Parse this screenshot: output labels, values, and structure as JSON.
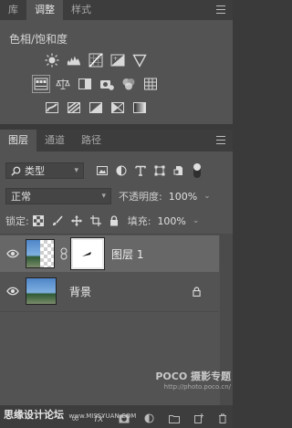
{
  "adjust_panel": {
    "tabs": [
      "库",
      "调整",
      "样式"
    ],
    "active_tab": 1,
    "title": "色相/饱和度",
    "row1": [
      "brightness-icon",
      "levels-icon",
      "curves-icon",
      "exposure-icon",
      "vibrance-icon"
    ],
    "row2": [
      "hue-saturation-icon",
      "color-balance-icon",
      "black-white-icon",
      "photo-filter-icon",
      "channel-mixer-icon",
      "color-lookup-icon"
    ],
    "row3": [
      "invert-icon",
      "posterize-icon",
      "threshold-icon",
      "selective-color-icon",
      "gradient-map-icon"
    ]
  },
  "layers_panel": {
    "tabs": [
      "图层",
      "通道",
      "路径"
    ],
    "active_tab": 0,
    "filter_label": "类型",
    "blend_mode": "正常",
    "opacity_label": "不透明度:",
    "opacity_value": "100%",
    "lock_label": "锁定:",
    "fill_label": "填充:",
    "fill_value": "100%",
    "layers": [
      {
        "name": "图层 1",
        "selected": true,
        "has_mask": true
      },
      {
        "name": "背景",
        "selected": false,
        "locked": true
      }
    ]
  },
  "watermark": {
    "poco": "POCO 摄影专题",
    "url": "http://photo.poco.cn/",
    "site": "思缘设计论坛",
    "site_url": "www.MISSYUAN.COM"
  },
  "colors": {
    "panel": "#535353",
    "dark": "#3a3a3a",
    "selected_row": "#676767"
  }
}
